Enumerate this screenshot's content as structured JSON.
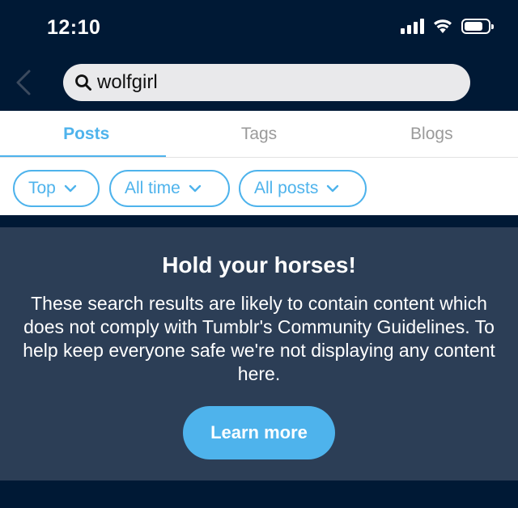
{
  "status_bar": {
    "time": "12:10",
    "icons": [
      "cellular-signal-icon",
      "wifi-icon",
      "battery-icon"
    ]
  },
  "header": {
    "back_icon": "chevron-left-icon",
    "search": {
      "icon": "search-icon",
      "value": "wolfgirl",
      "placeholder": ""
    }
  },
  "tabs": [
    {
      "label": "Posts",
      "active": true
    },
    {
      "label": "Tags",
      "active": false
    },
    {
      "label": "Blogs",
      "active": false
    }
  ],
  "filters": [
    {
      "label": "Top",
      "icon": "chevron-down-icon"
    },
    {
      "label": "All time",
      "icon": "chevron-down-icon"
    },
    {
      "label": "All posts",
      "icon": "chevron-down-icon"
    }
  ],
  "notice": {
    "title": "Hold your horses!",
    "body": "These search results are likely to contain content which does not comply with Tumblr's Community Guidelines. To help keep everyone safe we're not displaying any content here.",
    "button_label": "Learn more"
  },
  "colors": {
    "background": "#001935",
    "accent": "#4eb3ec",
    "panel": "#2c3e56",
    "white": "#ffffff",
    "inactive_tab": "#9a9a9a"
  }
}
